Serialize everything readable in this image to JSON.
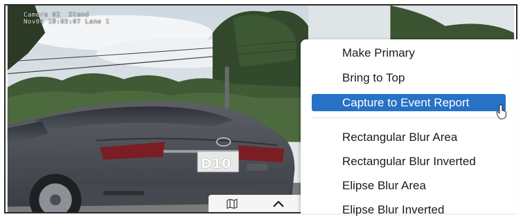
{
  "video": {
    "overlay_line1": "Camera 02  Stand",
    "overlay_line2": "Nov04 10:05:07 Lane 1",
    "plate_text": "D10"
  },
  "toolbar": {
    "map_icon": "map-icon",
    "expand_icon": "chevron-up-icon"
  },
  "context_menu": {
    "items": [
      {
        "label": "Make Primary"
      },
      {
        "label": "Bring to Top"
      },
      {
        "label": "Capture to Event Report",
        "highlighted": true
      },
      {
        "label": "Rectangular Blur Area"
      },
      {
        "label": "Rectangular Blur Inverted"
      },
      {
        "label": "Elipse Blur Area"
      },
      {
        "label": "Elipse Blur Inverted"
      }
    ],
    "highlight_color": "#2771c6"
  }
}
